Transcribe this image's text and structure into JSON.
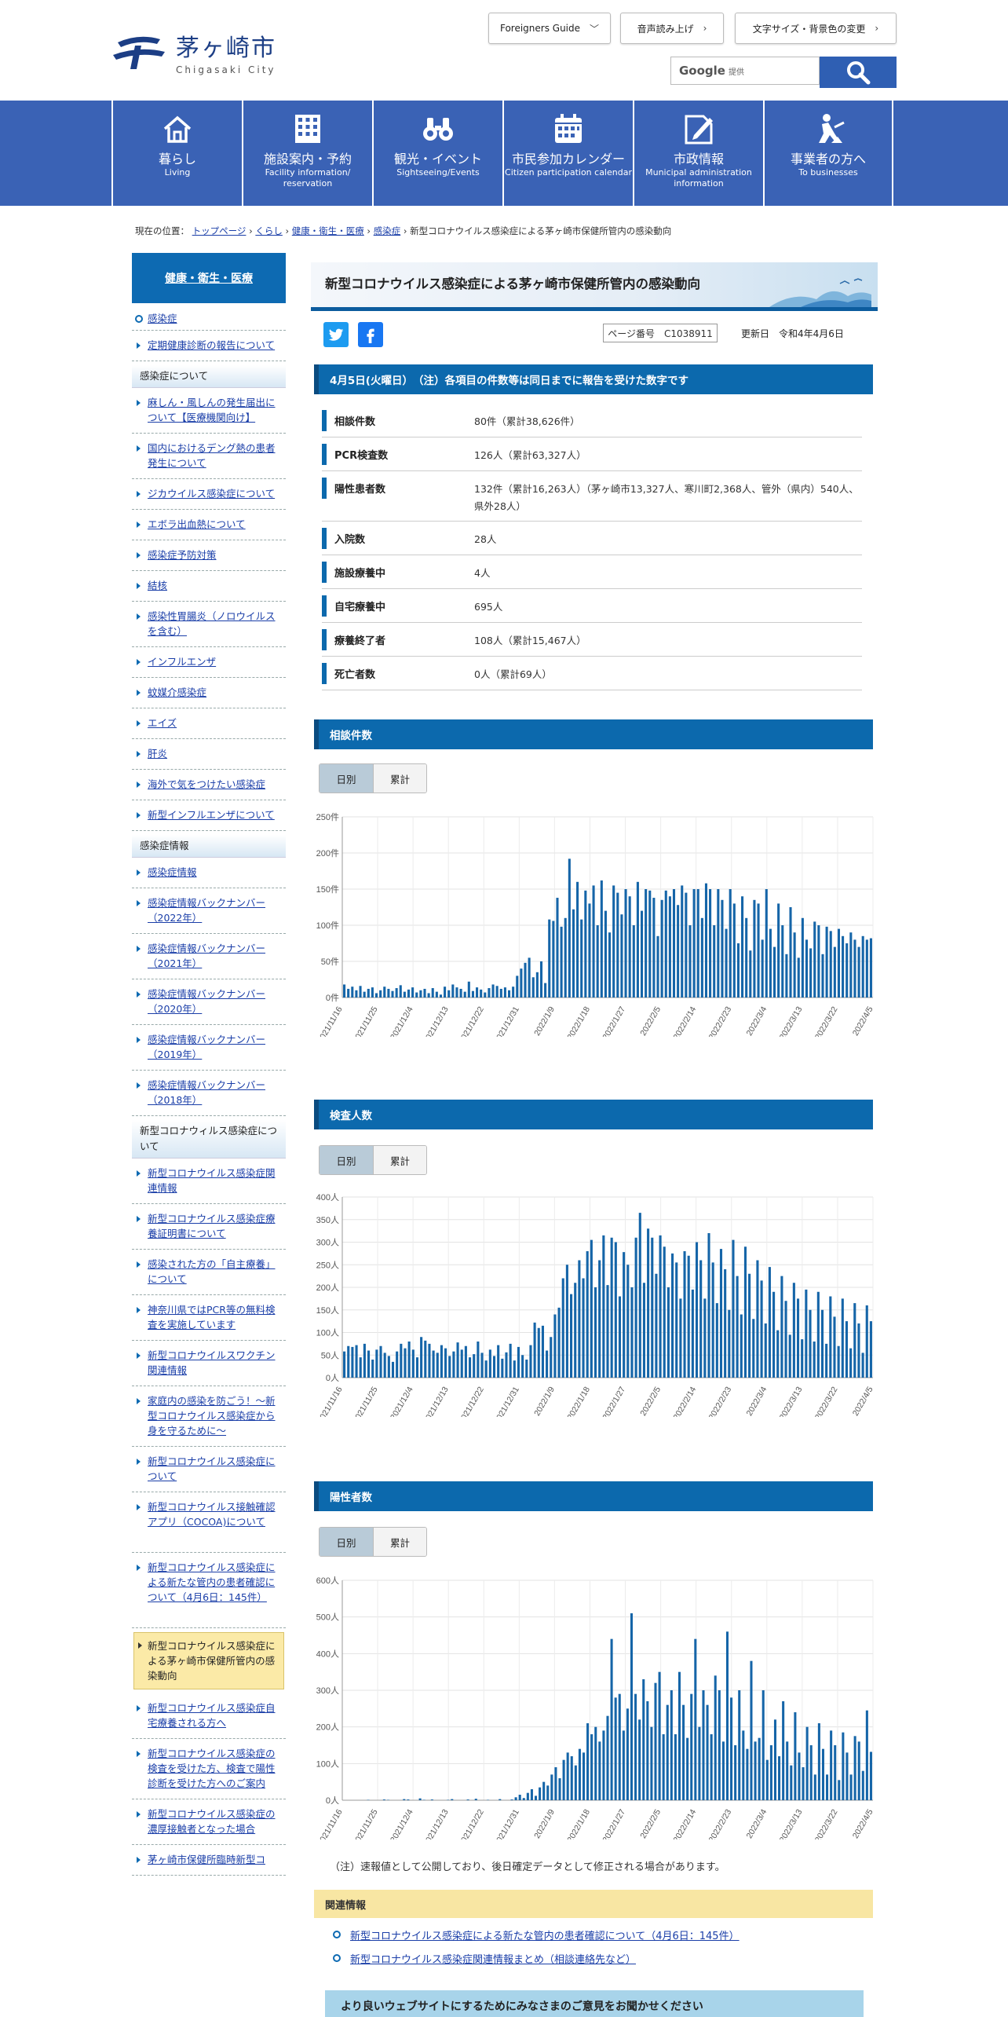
{
  "header": {
    "logo_jp": "茅ヶ崎市",
    "logo_en": "Chigasaki City",
    "foreigners_label": "Foreigners Guide",
    "voice_label": "音声読み上げ",
    "fontsize_label": "文字サイズ・背景色の変更",
    "search_google": "Google",
    "search_provided": "提供"
  },
  "nav": [
    {
      "jp": "暮らし",
      "en": "Living",
      "en2": ""
    },
    {
      "jp": "施設案内・予約",
      "en": "Facility information/",
      "en2": "reservation"
    },
    {
      "jp": "観光・イベント",
      "en": "Sightseeing/Events",
      "en2": ""
    },
    {
      "jp": "市民参加カレンダー",
      "en": "Citizen participation calendar",
      "en2": ""
    },
    {
      "jp": "市政情報",
      "en": "Municipal administration",
      "en2": "information"
    },
    {
      "jp": "事業者の方へ",
      "en": "To businesses",
      "en2": ""
    }
  ],
  "breadcrumb": {
    "prefix": "現在の位置：",
    "items": [
      "トップページ",
      "くらし",
      "健康・衛生・医療",
      "感染症"
    ],
    "current": "新型コロナウイルス感染症による茅ヶ崎市保健所管内の感染動向"
  },
  "sidebar": {
    "heading": "健康・衛生・医療",
    "top_link": "感染症",
    "links_a": [
      "定期健康診断の報告について"
    ],
    "section1": "感染症について",
    "links_b": [
      "麻しん・風しんの発生届出について【医療機関向け】",
      "国内におけるデング熱の患者発生について",
      "ジカウイルス感染症について",
      "エボラ出血熱について",
      "感染症予防対策",
      "結核",
      "感染性胃腸炎（ノロウイルスを含む）",
      "インフルエンザ",
      "蚊媒介感染症",
      "エイズ",
      "肝炎",
      "海外で気をつけたい感染症",
      "新型インフルエンザについて"
    ],
    "section2": "感染症情報",
    "links_c": [
      "感染症情報",
      "感染症情報バックナンバー（2022年）",
      "感染症情報バックナンバー（2021年）",
      "感染症情報バックナンバー（2020年）",
      "感染症情報バックナンバー（2019年）",
      "感染症情報バックナンバー（2018年）"
    ],
    "section3": "新型コロナウィルス感染症について",
    "links_d": [
      "新型コロナウイルス感染症関連情報",
      "新型コロナウイルス感染症療養証明書について",
      "感染された方の「自主療養」について",
      "神奈川県ではPCR等の無料検査を実施しています",
      "新型コロナウイルスワクチン関連情報",
      "家庭内の感染を防ごう！～新型コロナウイルス感染症から身を守るために～",
      "新型コロナウイルス感染症について",
      "新型コロナウイルス接触確認アプリ（COCOA)について",
      "新型コロナウイルス感染症による新たな管内の患者確認について（4月6日：145件）"
    ],
    "current": "新型コロナウイルス感染症による茅ヶ崎市保健所管内の感染動向",
    "links_e": [
      "新型コロナウイルス感染症自宅療養される方へ",
      "新型コロナウイルス感染症の検査を受けた方、検査で陽性診断を受けた方へのご案内",
      "新型コロナウイルス感染症の濃厚接触者となった場合",
      "茅ヶ崎市保健所臨時新型コ"
    ]
  },
  "main": {
    "title": "新型コロナウイルス感染症による茅ヶ崎市保健所管内の感染動向",
    "page_no": "ページ番号　C1038911",
    "updated": "更新日　令和4年4月6日",
    "date_bar": "4月5日(火曜日）　（注）各項目の件数等は同日までに報告を受けた数字です",
    "stats": [
      {
        "label": "相談件数",
        "value": "80件（累計38,626件）"
      },
      {
        "label": "PCR検査数",
        "value": "126人（累計63,327人）"
      },
      {
        "label": "陽性患者数",
        "value": "132件（累計16,263人）（茅ヶ崎市13,327人、寒川町2,368人、管外（県内）540人、県外28人）"
      },
      {
        "label": "入院数",
        "value": "28人"
      },
      {
        "label": "施設療養中",
        "value": "4人"
      },
      {
        "label": "自宅療養中",
        "value": "695人"
      },
      {
        "label": "療養終了者",
        "value": "108人（累計15,467人）"
      },
      {
        "label": "死亡者数",
        "value": "0人（累計69人）"
      }
    ],
    "toggle_daily": "日別",
    "toggle_cumulative": "累計",
    "note": "（注）速報値として公開しており、後日確定データとして修正される場合があります。",
    "related_heading": "関連情報",
    "related": [
      "新型コロナウイルス感染症による新たな管内の患者確認について（4月6日：145件）",
      "新型コロナウイルス感染症関連情報まとめ（相談連絡先など）"
    ],
    "feedback": "より良いウェブサイトにするためにみなさまのご意見をお聞かせください"
  },
  "colors": {
    "nav": "#3a62b5",
    "bar": "#0c69ad",
    "chart_bar": "#1565a8"
  },
  "chart_data": [
    {
      "type": "bar",
      "title": "相談件数",
      "x_ticks": [
        "2021/11/16",
        "2021/11/25",
        "2021/12/4",
        "2021/12/13",
        "2021/12/22",
        "2021/12/31",
        "2022/1/9",
        "2022/1/18",
        "2022/1/27",
        "2022/2/5",
        "2022/2/14",
        "2022/2/23",
        "2022/3/4",
        "2022/3/13",
        "2022/3/22",
        "2022/4/5"
      ],
      "y_ticks": [
        "0件",
        "50件",
        "100件",
        "150件",
        "200件",
        "250件"
      ],
      "ylim": [
        0,
        250
      ],
      "values": [
        18,
        12,
        15,
        10,
        16,
        8,
        12,
        14,
        6,
        10,
        15,
        12,
        9,
        13,
        17,
        8,
        11,
        14,
        7,
        10,
        12,
        6,
        13,
        8,
        4,
        15,
        10,
        18,
        14,
        12,
        8,
        22,
        9,
        14,
        11,
        7,
        13,
        18,
        16,
        12,
        14,
        10,
        15,
        30,
        40,
        48,
        55,
        28,
        35,
        50,
        20,
        108,
        106,
        138,
        98,
        110,
        192,
        122,
        160,
        108,
        148,
        130,
        155,
        100,
        162,
        120,
        90,
        155,
        145,
        115,
        150,
        140,
        100,
        160,
        120,
        150,
        148,
        138,
        85,
        135,
        148,
        140,
        150,
        128,
        155,
        145,
        100,
        150,
        150,
        110,
        158,
        150,
        100,
        150,
        135,
        95,
        150,
        130,
        75,
        140,
        110,
        65,
        135,
        130,
        80,
        150,
        95,
        70,
        130,
        100,
        60,
        125,
        90,
        55,
        110,
        80,
        68,
        105,
        100,
        60,
        98,
        92,
        70,
        95,
        85,
        75,
        90,
        80,
        70,
        85,
        80,
        82
      ]
    },
    {
      "type": "bar",
      "title": "検査人数",
      "x_ticks": [
        "2021/11/16",
        "2021/11/25",
        "2021/12/4",
        "2021/12/13",
        "2021/12/22",
        "2021/12/31",
        "2022/1/9",
        "2022/1/18",
        "2022/1/27",
        "2022/2/5",
        "2022/2/14",
        "2022/2/23",
        "2022/3/4",
        "2022/3/13",
        "2022/3/22",
        "2022/4/5"
      ],
      "y_ticks": [
        "0人",
        "50人",
        "100人",
        "150人",
        "200人",
        "250人",
        "300人",
        "350人",
        "400人"
      ],
      "ylim": [
        0,
        400
      ],
      "values": [
        58,
        70,
        68,
        72,
        45,
        75,
        60,
        40,
        62,
        70,
        55,
        48,
        35,
        58,
        75,
        65,
        80,
        62,
        45,
        90,
        82,
        75,
        60,
        55,
        72,
        65,
        48,
        58,
        78,
        62,
        70,
        45,
        52,
        80,
        55,
        38,
        62,
        48,
        72,
        42,
        56,
        75,
        38,
        68,
        50,
        40,
        72,
        122,
        110,
        115,
        60,
        90,
        140,
        155,
        220,
        250,
        185,
        210,
        260,
        220,
        280,
        305,
        200,
        260,
        315,
        205,
        310,
        300,
        180,
        278,
        250,
        200,
        310,
        365,
        210,
        330,
        310,
        230,
        315,
        290,
        200,
        275,
        255,
        175,
        280,
        270,
        195,
        300,
        260,
        175,
        320,
        255,
        165,
        285,
        240,
        150,
        305,
        225,
        140,
        290,
        230,
        130,
        260,
        215,
        120,
        245,
        190,
        105,
        225,
        170,
        95,
        210,
        175,
        85,
        195,
        150,
        80,
        190,
        150,
        75,
        180,
        135,
        70,
        175,
        125,
        65,
        165,
        120,
        55,
        160,
        125
      ]
    },
    {
      "type": "bar",
      "title": "陽性者数",
      "x_ticks": [
        "2021/11/16",
        "2021/11/25",
        "2021/12/4",
        "2021/12/13",
        "2021/12/22",
        "2021/12/31",
        "2022/1/9",
        "2022/1/18",
        "2022/1/27",
        "2022/2/5",
        "2022/2/14",
        "2022/2/23",
        "2022/3/4",
        "2022/3/13",
        "2022/3/22",
        "2022/4/5"
      ],
      "y_ticks": [
        "0人",
        "100人",
        "200人",
        "300人",
        "400人",
        "500人",
        "600人"
      ],
      "ylim": [
        0,
        600
      ],
      "values": [
        0,
        0,
        0,
        0,
        0,
        0,
        1,
        0,
        0,
        0,
        2,
        1,
        0,
        0,
        0,
        3,
        2,
        0,
        0,
        5,
        1,
        0,
        2,
        0,
        0,
        0,
        1,
        3,
        0,
        0,
        0,
        2,
        0,
        4,
        0,
        0,
        1,
        0,
        0,
        3,
        0,
        0,
        2,
        8,
        15,
        6,
        20,
        30,
        12,
        35,
        50,
        40,
        70,
        90,
        60,
        110,
        130,
        120,
        95,
        140,
        130,
        210,
        180,
        200,
        160,
        190,
        230,
        440,
        280,
        290,
        190,
        250,
        510,
        290,
        220,
        330,
        270,
        200,
        320,
        350,
        180,
        260,
        300,
        180,
        350,
        260,
        170,
        290,
        440,
        200,
        300,
        260,
        180,
        340,
        300,
        160,
        460,
        280,
        150,
        300,
        190,
        140,
        380,
        160,
        170,
        300,
        110,
        150,
        220,
        120,
        270,
        160,
        95,
        240,
        130,
        90,
        200,
        150,
        70,
        210,
        140,
        70,
        190,
        150,
        55,
        185,
        130,
        70,
        175,
        160,
        80,
        245,
        132
      ]
    }
  ]
}
